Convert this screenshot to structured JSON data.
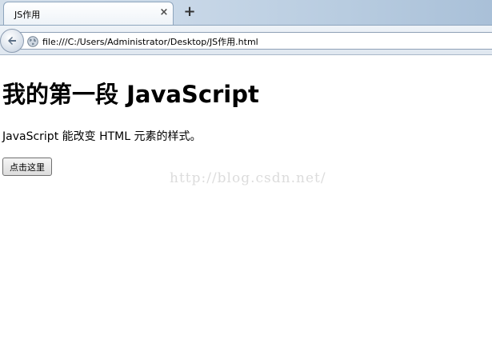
{
  "browser": {
    "tab": {
      "title": "JS作用",
      "close_glyph": "×"
    },
    "new_tab_glyph": "+",
    "address_bar": {
      "url": "file:///C:/Users/Administrator/Desktop/JS作用.html"
    }
  },
  "page": {
    "heading": "我的第一段 JavaScript",
    "paragraph": "JavaScript 能改变 HTML 元素的样式。",
    "button_label": "点击这里",
    "watermark": "http://blog.csdn.net/"
  },
  "colors": {
    "tabstrip_bg": "#c9d8e8",
    "page_bg": "#ffffff",
    "watermark": "#dcdcdc"
  },
  "icons": [
    "back-arrow-icon",
    "globe-icon",
    "close-icon",
    "plus-icon"
  ]
}
